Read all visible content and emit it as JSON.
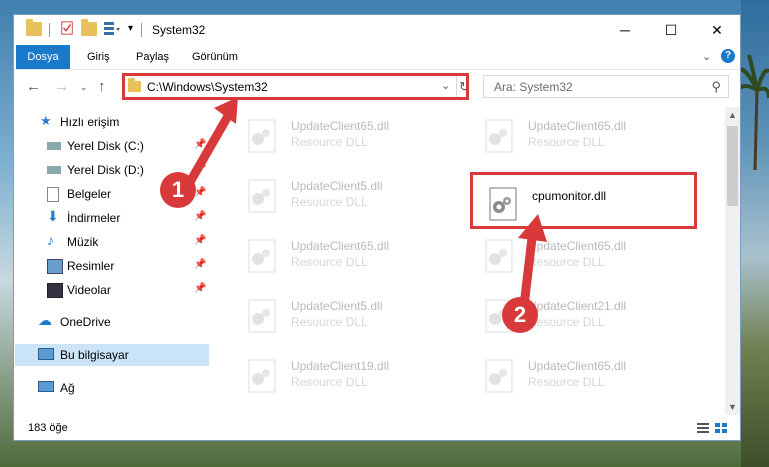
{
  "window": {
    "title": "System32"
  },
  "ribbon": {
    "tabs": [
      "Dosya",
      "Giriş",
      "Paylaş",
      "Görünüm"
    ]
  },
  "address": {
    "path": "C:\\Windows\\System32"
  },
  "search": {
    "placeholder": "Ara: System32"
  },
  "sidebar": {
    "items": [
      {
        "label": "Hızlı erişim"
      },
      {
        "label": "Yerel Disk (C:)"
      },
      {
        "label": "Yerel Disk (D:)"
      },
      {
        "label": "Belgeler"
      },
      {
        "label": "İndirmeler"
      },
      {
        "label": "Müzik"
      },
      {
        "label": "Resimler"
      },
      {
        "label": "Videolar"
      },
      {
        "label": "OneDrive"
      },
      {
        "label": "Bu bilgisayar"
      },
      {
        "label": "Ağ"
      }
    ]
  },
  "files": [
    {
      "name": "UpdateClient65.dll",
      "desc": "Resource DLL"
    },
    {
      "name": "UpdateClient65.dll",
      "desc": "Resource DLL"
    },
    {
      "name": "UpdateClient5.dll",
      "desc": "Resource DLL"
    },
    {
      "name": "cpumonitor.dll",
      "desc": ""
    },
    {
      "name": "UpdateClient65.dll",
      "desc": "Resource DLL"
    },
    {
      "name": "UpdateClient65.dll",
      "desc": "Resource DLL"
    },
    {
      "name": "UpdateClient5.dll",
      "desc": "Resource DLL"
    },
    {
      "name": "UpdateClient21.dll",
      "desc": "Resource DLL"
    },
    {
      "name": "UpdateClient19.dll",
      "desc": "Resource DLL"
    },
    {
      "name": "UpdateClient65.dll",
      "desc": "Resource DLL"
    }
  ],
  "status": {
    "count": "183 öğe"
  },
  "callouts": [
    "1",
    "2"
  ],
  "colors": {
    "accent": "#1979ca",
    "highlight": "#d8393a",
    "selected": "#cce4f7"
  }
}
